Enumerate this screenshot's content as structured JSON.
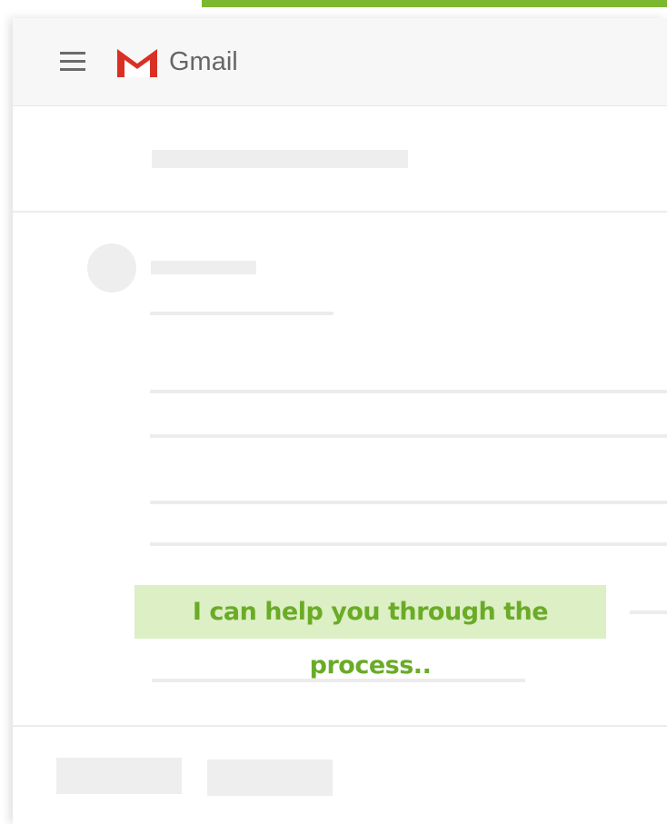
{
  "app": {
    "name": "Gmail",
    "brand_accent": "#7cb82f",
    "logo_red": "#d93025"
  },
  "header": {
    "menu_icon": "hamburger-menu-icon",
    "logo_icon": "gmail-m-logo-icon"
  },
  "tooltip": {
    "text": "I can help you through the process.."
  }
}
